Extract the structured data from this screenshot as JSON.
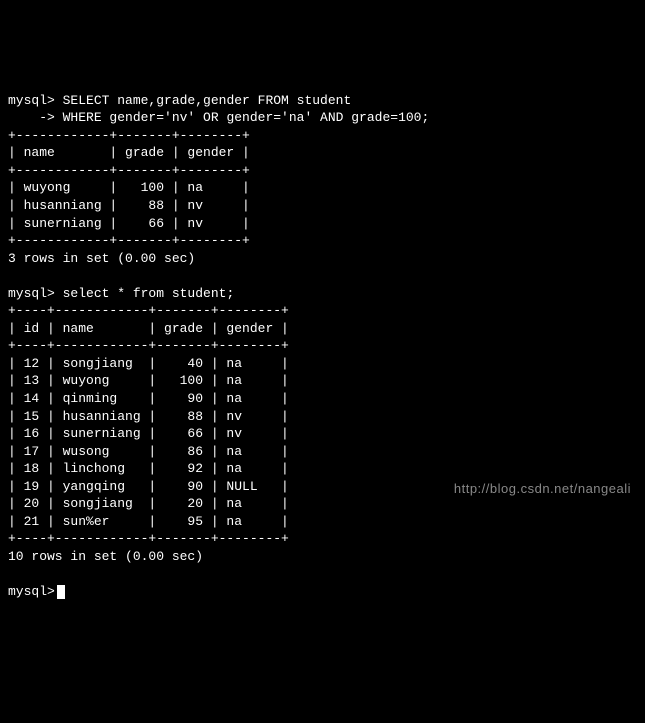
{
  "prompt_label": "mysql>",
  "continuation_label": "    ->",
  "query1": {
    "line1": " SELECT name,grade,gender FROM student",
    "line2": " WHERE gender='nv' OR gender='na' AND grade=100;",
    "sep": "+------------+-------+--------+",
    "header": "| name       | grade | gender |",
    "rows": [
      "| wuyong     |   100 | na     |",
      "| husanniang |    88 | nv     |",
      "| sunerniang |    66 | nv     |"
    ],
    "footer": "3 rows in set (0.00 sec)"
  },
  "query2": {
    "line1": " select * from student;",
    "sep": "+----+------------+-------+--------+",
    "header": "| id | name       | grade | gender |",
    "rows": [
      "| 12 | songjiang  |    40 | na     |",
      "| 13 | wuyong     |   100 | na     |",
      "| 14 | qinming    |    90 | na     |",
      "| 15 | husanniang |    88 | nv     |",
      "| 16 | sunerniang |    66 | nv     |",
      "| 17 | wusong     |    86 | na     |",
      "| 18 | linchong   |    92 | na     |",
      "| 19 | yangqing   |    90 | NULL   |",
      "| 20 | songjiang  |    20 | na     |",
      "| 21 | sun%er     |    95 | na     |"
    ],
    "footer": "10 rows in set (0.00 sec)"
  },
  "watermark": "http://blog.csdn.net/nangeali"
}
